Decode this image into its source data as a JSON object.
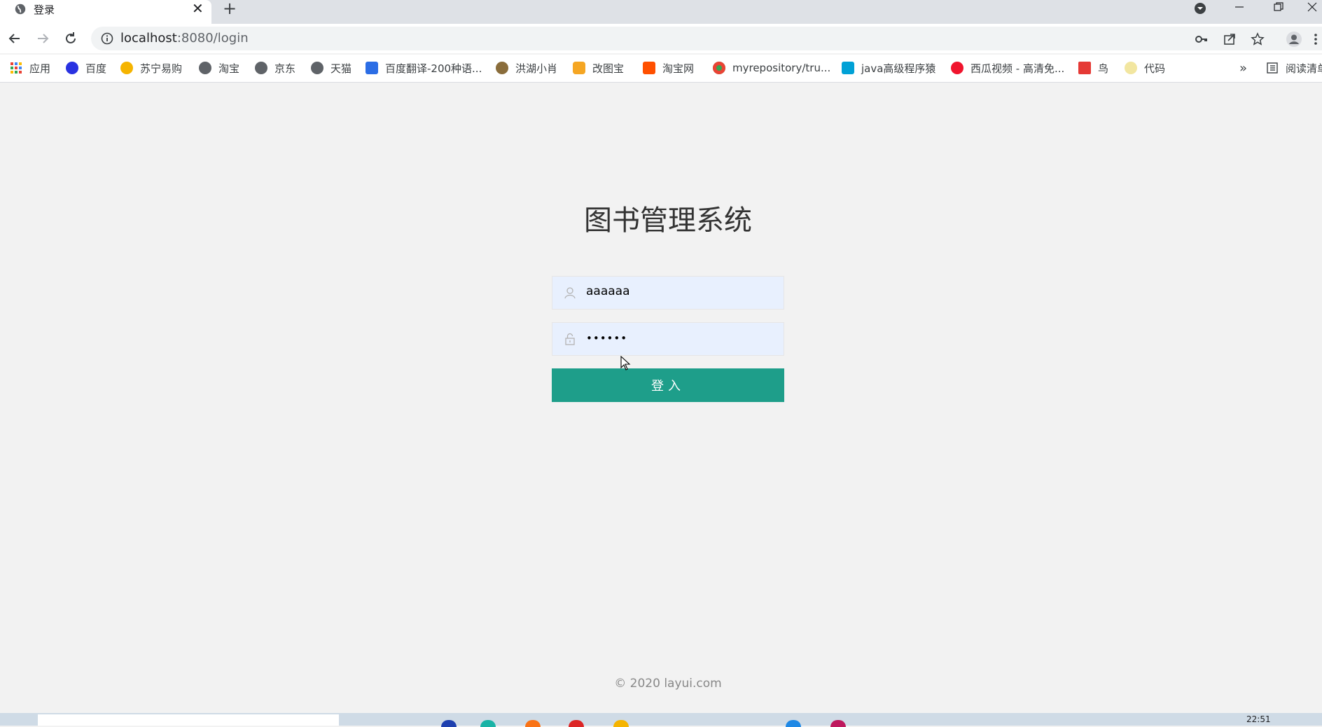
{
  "tab": {
    "title": "登录",
    "close": "✕",
    "new_tab": "+"
  },
  "address_bar": {
    "host": "localhost",
    "path": ":8080/login"
  },
  "bookmarks": [
    {
      "label": "应用",
      "icon": "apps-grid-icon",
      "color": "#ea4335"
    },
    {
      "label": "百度",
      "icon": "baidu-paw-icon",
      "color": "#2932e1"
    },
    {
      "label": "苏宁易购",
      "icon": "suning-icon",
      "color": "#f5b400"
    },
    {
      "label": "淘宝",
      "icon": "globe-icon",
      "color": "#5f6368"
    },
    {
      "label": "京东",
      "icon": "globe-icon",
      "color": "#5f6368"
    },
    {
      "label": "天猫",
      "icon": "globe-icon",
      "color": "#5f6368"
    },
    {
      "label": "百度翻译-200种语...",
      "icon": "translate-icon",
      "color": "#2b6de5"
    },
    {
      "label": "洪湖小肖",
      "icon": "bird-icon",
      "color": "#8a6d3b"
    },
    {
      "label": "改图宝",
      "icon": "gaitubao-icon",
      "color": "#f5a623"
    },
    {
      "label": "淘宝网",
      "icon": "taobao-icon",
      "color": "#ff5000"
    },
    {
      "label": "myrepository/tru...",
      "icon": "chrome-icon",
      "color": "#34a853"
    },
    {
      "label": "java高级程序猿",
      "icon": "bilibili-icon",
      "color": "#00a1d6"
    },
    {
      "label": "西瓜视频 - 高清免...",
      "icon": "xigua-icon",
      "color": "#f0142d"
    },
    {
      "label": "鸟",
      "icon": "bird-red-icon",
      "color": "#e53935"
    },
    {
      "label": "代码",
      "icon": "leaf-icon",
      "color": "#f2e6a0"
    }
  ],
  "bookmarks_overflow": "»",
  "reading_list": "阅读清单",
  "login": {
    "title": "图书管理系统",
    "username_value": "aaaaaa",
    "password_value": "••••••",
    "submit_label": "登入"
  },
  "footer": {
    "text": "© 2020  layui.com"
  },
  "taskbar": {
    "clock": "22:51"
  },
  "colors": {
    "accent": "#1e9e8a",
    "page_bg": "#f2f2f2",
    "autofill_bg": "#e8f0fe"
  }
}
